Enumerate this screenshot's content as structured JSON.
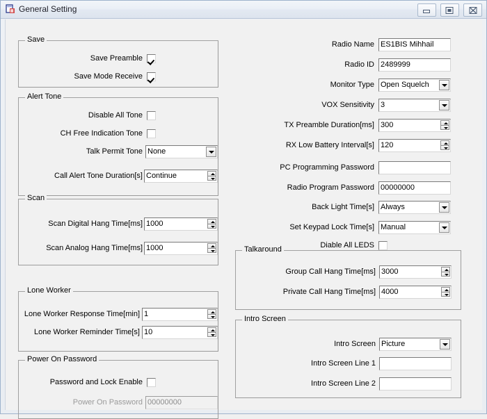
{
  "window": {
    "title": "General Setting",
    "icon": "form-window-icon",
    "buttons": [
      {
        "name": "minimize-button",
        "glyph": "minimize-icon"
      },
      {
        "name": "maximize-button",
        "glyph": "maximize-icon"
      },
      {
        "name": "close-button",
        "glyph": "close-icon"
      }
    ]
  },
  "left": {
    "save": {
      "title": "Save",
      "save_preamble_label": "Save Preamble",
      "save_preamble_checked": "checked",
      "save_mode_receive_label": "Save Mode Receive",
      "save_mode_receive_checked": "checked"
    },
    "alert_tone": {
      "title": "Alert Tone",
      "disable_all_tone_label": "Disable All Tone",
      "ch_free_indication_tone_label": "CH Free Indication Tone",
      "talk_permit_tone_label": "Talk Permit Tone",
      "talk_permit_tone_value": "None",
      "call_alert_tone_duration_label": "Call Alert Tone Duration[s]",
      "call_alert_tone_duration_value": "Continue"
    },
    "scan": {
      "title": "Scan",
      "scan_digital_hang_time_label": "Scan Digital Hang Time[ms]",
      "scan_digital_hang_time_value": "1000",
      "scan_analog_hang_time_label": "Scan Analog Hang Time[ms]",
      "scan_analog_hang_time_value": "1000"
    },
    "lone_worker": {
      "title": "Lone Worker",
      "response_time_label": "Lone Worker Response Time[min]",
      "response_time_value": "1",
      "reminder_time_label": "Lone Worker Reminder Time[s]",
      "reminder_time_value": "10"
    },
    "power_on_password": {
      "title": "Power On Password",
      "password_and_lock_enable_label": "Password and Lock Enable",
      "power_on_password_label": "Power On Password",
      "power_on_password_value": "00000000"
    }
  },
  "right": {
    "radio_name_label": "Radio Name",
    "radio_name_value": "ES1BIS Mihhail",
    "radio_id_label": "Radio ID",
    "radio_id_value": "2489999",
    "monitor_type_label": "Monitor Type",
    "monitor_type_value": "Open Squelch",
    "vox_sensitivity_label": "VOX Sensitivity",
    "vox_sensitivity_value": "3",
    "tx_preamble_duration_label": "TX Preamble Duration[ms]",
    "tx_preamble_duration_value": "300",
    "rx_low_battery_interval_label": "RX Low Battery Interval[s]",
    "rx_low_battery_interval_value": "120",
    "pc_programming_password_label": "PC Programming Password",
    "pc_programming_password_value": "",
    "radio_program_password_label": "Radio Program Password",
    "radio_program_password_value": "00000000",
    "back_light_time_label": "Back Light Time[s]",
    "back_light_time_value": "Always",
    "set_keypad_lock_time_label": "Set Keypad Lock Time[s]",
    "set_keypad_lock_time_value": "Manual",
    "disable_all_leds_label": "Diable All LEDS",
    "talkaround": {
      "title": "Talkaround",
      "group_call_hang_time_label": "Group Call Hang Time[ms]",
      "group_call_hang_time_value": "3000",
      "private_call_hang_time_label": "Private Call Hang Time[ms]",
      "private_call_hang_time_value": "4000"
    },
    "intro_screen": {
      "title": "Intro Screen",
      "intro_screen_label": "Intro Screen",
      "intro_screen_value": "Picture",
      "line1_label": "Intro Screen Line 1",
      "line1_value": "",
      "line2_label": "Intro Screen Line 2",
      "line2_value": ""
    }
  }
}
